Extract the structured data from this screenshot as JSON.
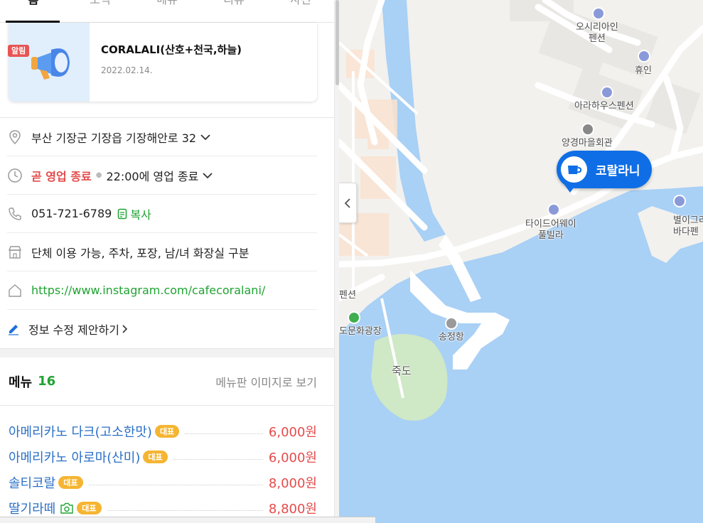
{
  "tabs": [
    {
      "label": "홈"
    },
    {
      "label": "소식"
    },
    {
      "label": "메뉴"
    },
    {
      "label": "리뷰"
    },
    {
      "label": "사진"
    }
  ],
  "notice": {
    "badge": "알림",
    "title": "CORALALI(산호+천국,하늘)",
    "date": "2022.02.14."
  },
  "info": {
    "address": "부산 기장군 기장읍 기장해안로 32",
    "status": "곧 영업 종료",
    "hours": "22:00에 영업 종료",
    "phone": "051-721-6789",
    "copy_label": "복사",
    "amenities": "단체 이용 가능, 주차, 포장, 남/녀 화장실 구분",
    "website": "https://www.instagram.com/cafecoralani/",
    "suggest": "정보 수정 제안하기"
  },
  "menu": {
    "title": "메뉴",
    "count": "16",
    "board_link": "메뉴판 이미지로 보기",
    "rep_label": "대표",
    "items": [
      {
        "name": "아메리카노 다크(고소한맛)",
        "price": "6,000원"
      },
      {
        "name": "아메리카노 아로마(산미)",
        "price": "6,000원"
      },
      {
        "name": "솔티코랄",
        "price": "8,000원"
      },
      {
        "name": "딸기라떼",
        "price": "8,800원"
      }
    ]
  },
  "map": {
    "place_label": "코랄라니",
    "labels": [
      {
        "text": "오시리아인\n펜션"
      },
      {
        "text": "휴인"
      },
      {
        "text": "아라하우스펜션"
      },
      {
        "text": "양경마을회관"
      },
      {
        "text": "타이드어웨이\n풀빌라"
      },
      {
        "text": "별이그리\n바다펜"
      },
      {
        "text": "펜션"
      },
      {
        "text": "도문화광장"
      },
      {
        "text": "송정항"
      },
      {
        "text": "죽도"
      }
    ]
  },
  "colors": {
    "brand_blue": "#0f6ee6",
    "green": "#1fa332",
    "red": "#e54b4b",
    "water": "#a7d0f5"
  }
}
